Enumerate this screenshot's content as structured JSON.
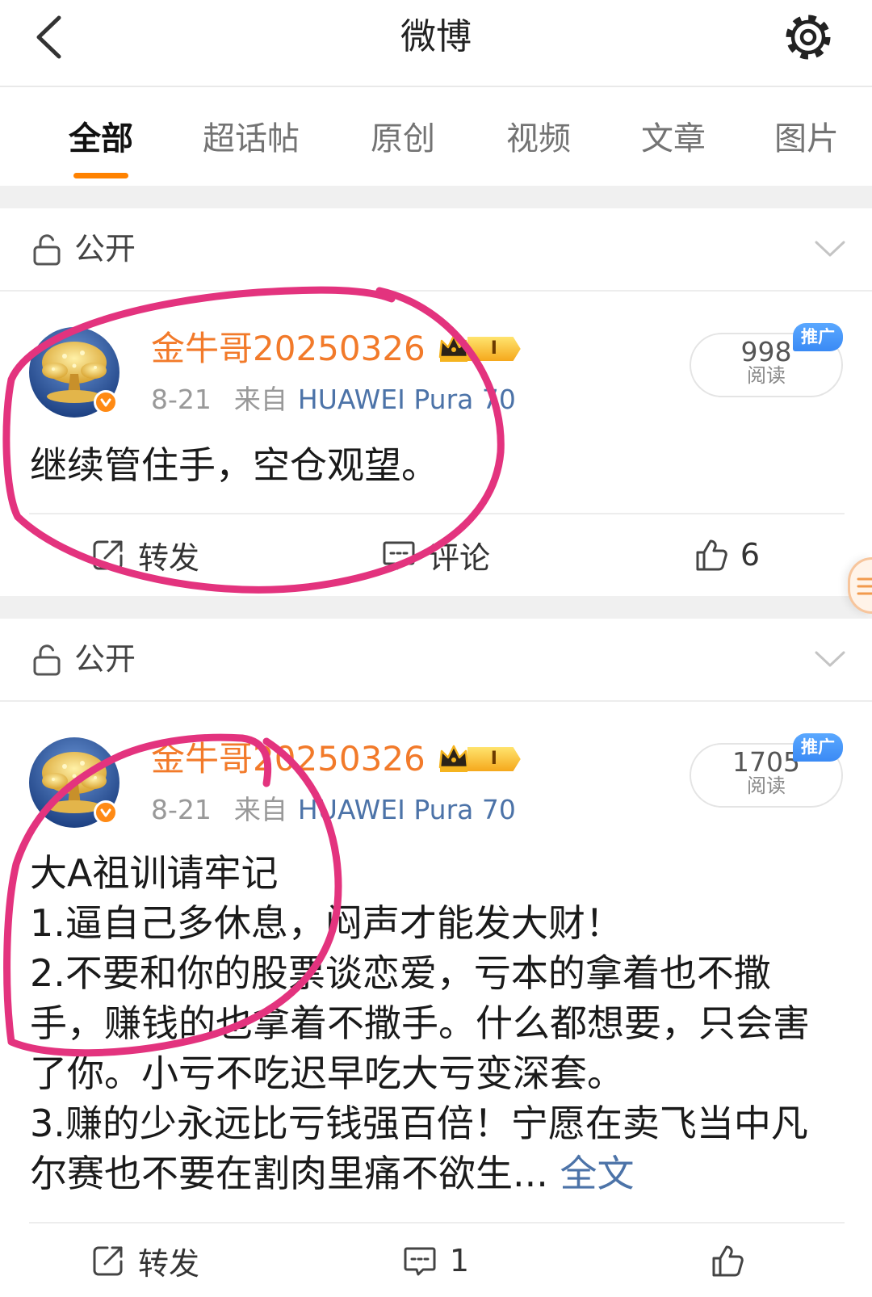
{
  "header": {
    "title": "微博",
    "back_icon": "back-arrow-icon",
    "settings_icon": "gear-icon"
  },
  "tabs": [
    {
      "label": "全部",
      "active": true
    },
    {
      "label": "超话帖",
      "active": false
    },
    {
      "label": "原创",
      "active": false
    },
    {
      "label": "视频",
      "active": false
    },
    {
      "label": "文章",
      "active": false
    },
    {
      "label": "图片",
      "active": false
    }
  ],
  "colors": {
    "accent": "#ff8200",
    "username": "#f27a2a",
    "link": "#4c73a8",
    "promo": "#3a8af5",
    "annotation": "#e3337e",
    "verified": "#ff8a14"
  },
  "posts": [
    {
      "visibility": "公开",
      "visibility_icon": "lock-open-icon",
      "user": {
        "name": "金牛哥20250326",
        "vip_level": "I",
        "verified": true
      },
      "date": "8-21",
      "source_prefix": "来自",
      "source": "HUAWEI Pura 70",
      "reads": {
        "count": "998",
        "label": "阅读"
      },
      "promo_tag": "推广",
      "content": [
        "继续管住手，空仓观望。"
      ],
      "actions": {
        "repost": "转发",
        "comment": "评论",
        "like": "6"
      }
    },
    {
      "visibility": "公开",
      "visibility_icon": "lock-open-icon",
      "user": {
        "name": "金牛哥20250326",
        "vip_level": "I",
        "verified": true
      },
      "date": "8-21",
      "source_prefix": "来自",
      "source": "HUAWEI Pura 70",
      "reads": {
        "count": "1705",
        "label": "阅读"
      },
      "promo_tag": "推广",
      "content": [
        "大A祖训请牢记",
        "1.逼自己多休息，闷声才能发大财！",
        "2.不要和你的股票谈恋爱，亏本的拿着也不撒手，赚钱的也拿着不撒手。什么都想要，只会害了你。小亏不吃迟早吃大亏变深套。",
        "3.赚的少永远比亏钱强百倍！宁愿在卖飞当中凡尔赛也不要在割肉里痛不欲生..."
      ],
      "more_link": "全文",
      "actions": {
        "repost": "转发",
        "comment": "1"
      }
    }
  ]
}
